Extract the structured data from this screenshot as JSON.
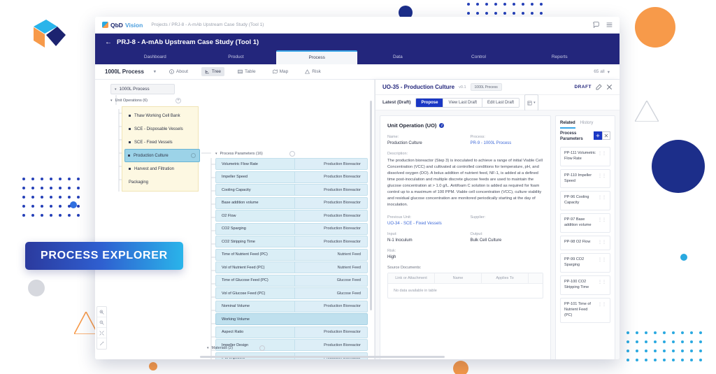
{
  "branding": {
    "logo_icon": "cube-logo",
    "pill_label": "PROCESS EXPLORER"
  },
  "topbar": {
    "brand_primary": "QbD",
    "brand_secondary": "Vision",
    "breadcrumb": "Projects / PRJ-8 - A-mAb Upstream Case Study (Tool 1)",
    "chat_icon": "chat-icon",
    "menu_icon": "hamburger-menu-icon"
  },
  "project_header": {
    "back_arrow": "←",
    "title": "PRJ-8 - A-mAb Upstream Case Study (Tool 1)"
  },
  "nav_tabs": [
    {
      "label": "Dashboard",
      "active": false
    },
    {
      "label": "Product",
      "active": false
    },
    {
      "label": "Process",
      "active": true
    },
    {
      "label": "Data",
      "active": false
    },
    {
      "label": "Control",
      "active": false
    },
    {
      "label": "Reports",
      "active": false
    }
  ],
  "toolbar": {
    "process_select": "1000L Process",
    "caret": "▾",
    "views": [
      {
        "label": "About",
        "icon": "info-icon",
        "active": false
      },
      {
        "label": "Tree",
        "icon": "tree-icon",
        "active": true
      },
      {
        "label": "Table",
        "icon": "table-icon",
        "active": false
      },
      {
        "label": "Map",
        "icon": "map-icon",
        "active": false
      },
      {
        "label": "Risk",
        "icon": "risk-icon",
        "active": false
      }
    ],
    "right_label": "65 all",
    "right_caret": "▾"
  },
  "tree": {
    "root_label": "1000L Process",
    "unit_operations_label": "Unit Operations (6)",
    "unit_operations": [
      {
        "label": "Thaw Working Cell Bank",
        "selected": false
      },
      {
        "label": "SCE - Disposable Vessels",
        "selected": false
      },
      {
        "label": "SCE - Fixed Vessels",
        "selected": false
      },
      {
        "label": "Production Culture",
        "selected": true
      },
      {
        "label": "Harvest and Filtration",
        "selected": false
      },
      {
        "label": "Packaging",
        "selected": false
      }
    ],
    "process_parameters_label": "Process Parameters (16)",
    "materials_label": "Materials (2)",
    "process_parameters": [
      {
        "name": "Volumetric Flow Rate",
        "source": "Production Bioreactor",
        "wide": false
      },
      {
        "name": "Impeller Speed",
        "source": "Production Bioreactor",
        "wide": false
      },
      {
        "name": "Cooling Capacity",
        "source": "Production Bioreactor",
        "wide": false
      },
      {
        "name": "Base addition volume",
        "source": "Production Bioreactor",
        "wide": false
      },
      {
        "name": "O2 Flow",
        "source": "Production Bioreactor",
        "wide": false
      },
      {
        "name": "CO2 Sparging",
        "source": "Production Bioreactor",
        "wide": false
      },
      {
        "name": "CO2 Stripping Time",
        "source": "Production Bioreactor",
        "wide": false
      },
      {
        "name": "Time of Nutrient Feed (PC)",
        "source": "Nutrient Feed",
        "wide": false
      },
      {
        "name": "Vol of Nutrient Feed (PC)",
        "source": "Nutrient Feed",
        "wide": false
      },
      {
        "name": "Time of Glucose Feed (PC)",
        "source": "Glucose Feed",
        "wide": false
      },
      {
        "name": "Vol of Glucose Feed (PC)",
        "source": "Glucose Feed",
        "wide": false
      },
      {
        "name": "Nominal Volume",
        "source": "Production Bioreactor",
        "wide": false
      },
      {
        "name": "Working Volume",
        "source": "",
        "wide": true
      },
      {
        "name": "Aspect Ratio",
        "source": "Production Bioreactor",
        "wide": false
      },
      {
        "name": "Impeller Design",
        "source": "Production Bioreactor",
        "wide": false
      },
      {
        "name": "# of Impellers",
        "source": "Production Bioreactor",
        "wide": false
      }
    ],
    "zoom_controls": [
      {
        "icon": "zoom-in-icon"
      },
      {
        "icon": "zoom-out-icon"
      },
      {
        "icon": "fit-screen-icon"
      },
      {
        "icon": "fullscreen-icon"
      }
    ]
  },
  "detail": {
    "title": "UO-35 - Production Culture",
    "version": "v0.1",
    "process_badge": "1000L Process",
    "draft_label": "DRAFT",
    "edit_icon": "edit-icon",
    "close_icon": "close-icon",
    "latest_label": "Latest (Draft)",
    "actions": [
      {
        "label": "Propose",
        "primary": true
      },
      {
        "label": "View Last Draft",
        "primary": false
      },
      {
        "label": "Edit Last Draft",
        "primary": false
      }
    ],
    "export_icon": "export-icon",
    "export_caret": "▾",
    "card": {
      "heading": "Unit Operation (UO)",
      "info_icon": "info-icon",
      "name_label": "Name:",
      "name_value": "Production Culture",
      "process_label": "Process:",
      "process_value": "PR-9 - 1000L Process",
      "description_label": "Description:",
      "description_value": "The production bioreactor (Step 3) is inoculated to achieve a range of initial Viable Cell Concentration (VCC) and cultivated at controlled conditions for temperature, pH, and dissolved oxygen (DO). A bolus addition of nutrient feed, NF-1, is added at a defined time post-inoculation and multiple discrete glucose feeds are used to maintain the glucose concentration at > 1.0 g/L. Antifoam C solution is added as required for foam control up to a maximum of 100 PPM. Viable cell concentration (VCC), culture viability and residual glucose concentration are monitored periodically starting at the day of inoculation.",
      "previous_unit_label": "Previous Unit:",
      "previous_unit_value": "UO-34 - SCE - Fixed Vessels",
      "supplier_label": "Supplier:",
      "supplier_value": "",
      "input_label": "Input:",
      "input_value": "N-1 Inoculum",
      "output_label": "Output:",
      "output_value": "Bulk Cell Culture",
      "risk_label": "Risk:",
      "risk_value": "High",
      "source_documents_label": "Source Documents:",
      "source_table_headers": [
        "Link or Attachment",
        "Name",
        "Applies To"
      ],
      "source_table_empty": "No data available in table"
    },
    "related": {
      "tabs": [
        {
          "label": "Related",
          "active": true
        },
        {
          "label": "History",
          "active": false
        }
      ],
      "section_title": "Process Parameters",
      "toggle_on_icon": "grid-view-icon",
      "toggle_off_icon": "close-icon",
      "items": [
        {
          "label": "PP-111 Volumetric Flow Rate"
        },
        {
          "label": "PP-110 Impeller Speed"
        },
        {
          "label": "PP-96 Cooling Capacity"
        },
        {
          "label": "PP-97 Base addition volume"
        },
        {
          "label": "PP-98 O2 Flow"
        },
        {
          "label": "PP-99 CO2 Sparging"
        },
        {
          "label": "PP-100 CO2 Stripping Time"
        },
        {
          "label": "PP-101 Time of Nutrient Feed (PC)"
        }
      ]
    }
  },
  "colors": {
    "brand_navy": "#23267c",
    "brand_blue": "#1a37c4",
    "accent_cyan": "#3aa7e8",
    "accent_orange": "#f79a4a",
    "param_blue": "#daeef6",
    "uo_yellow": "#fdf8e2",
    "selected_teal": "#9cd3e8"
  }
}
